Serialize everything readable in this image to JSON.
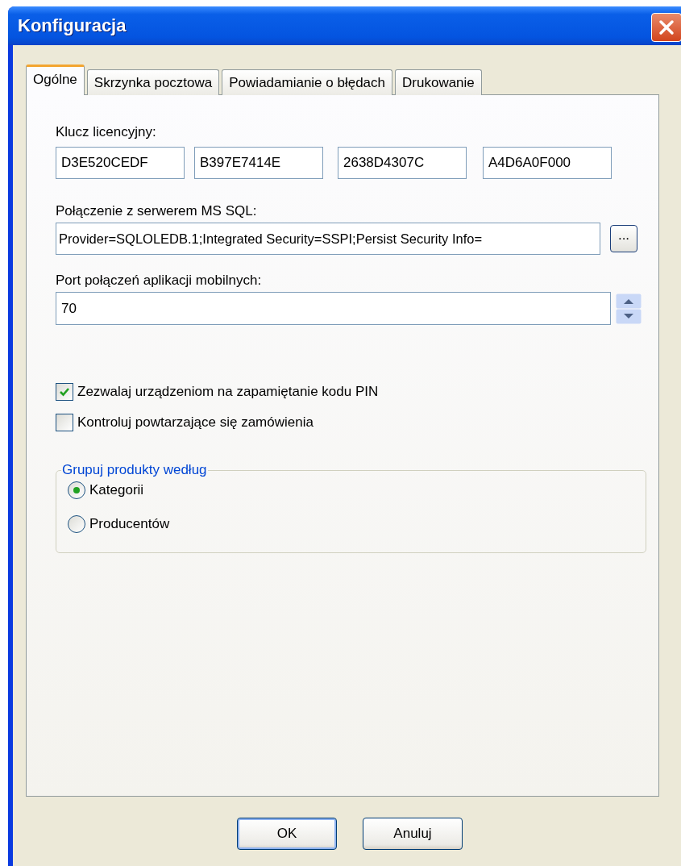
{
  "window": {
    "title": "Konfiguracja"
  },
  "tabs": [
    {
      "label": "Ogólne",
      "selected": true
    },
    {
      "label": "Skrzynka pocztowa",
      "selected": false
    },
    {
      "label": "Powiadamianie o błędach",
      "selected": false
    },
    {
      "label": "Drukowanie",
      "selected": false
    }
  ],
  "license": {
    "label": "Klucz licencyjny:",
    "parts": [
      "D3E520CEDF",
      "B397E7414E",
      "2638D4307C",
      "A4D6A0F000"
    ]
  },
  "connection": {
    "label": "Połączenie z serwerem MS SQL:",
    "value": "Provider=SQLOLEDB.1;Integrated Security=SSPI;Persist Security Info=",
    "browse_button": "..."
  },
  "port": {
    "label": "Port połączeń aplikacji mobilnych:",
    "value": "70"
  },
  "checkboxes": [
    {
      "label": "Zezwalaj urządzeniom na zapamiętanie kodu PIN",
      "checked": true
    },
    {
      "label": "Kontroluj powtarzające się zamówienia",
      "checked": false
    }
  ],
  "group": {
    "title": "Grupuj produkty według",
    "options": [
      {
        "label": "Kategorii",
        "selected": true
      },
      {
        "label": "Producentów",
        "selected": false
      }
    ]
  },
  "buttons": [
    "OK",
    "Anuluj"
  ]
}
